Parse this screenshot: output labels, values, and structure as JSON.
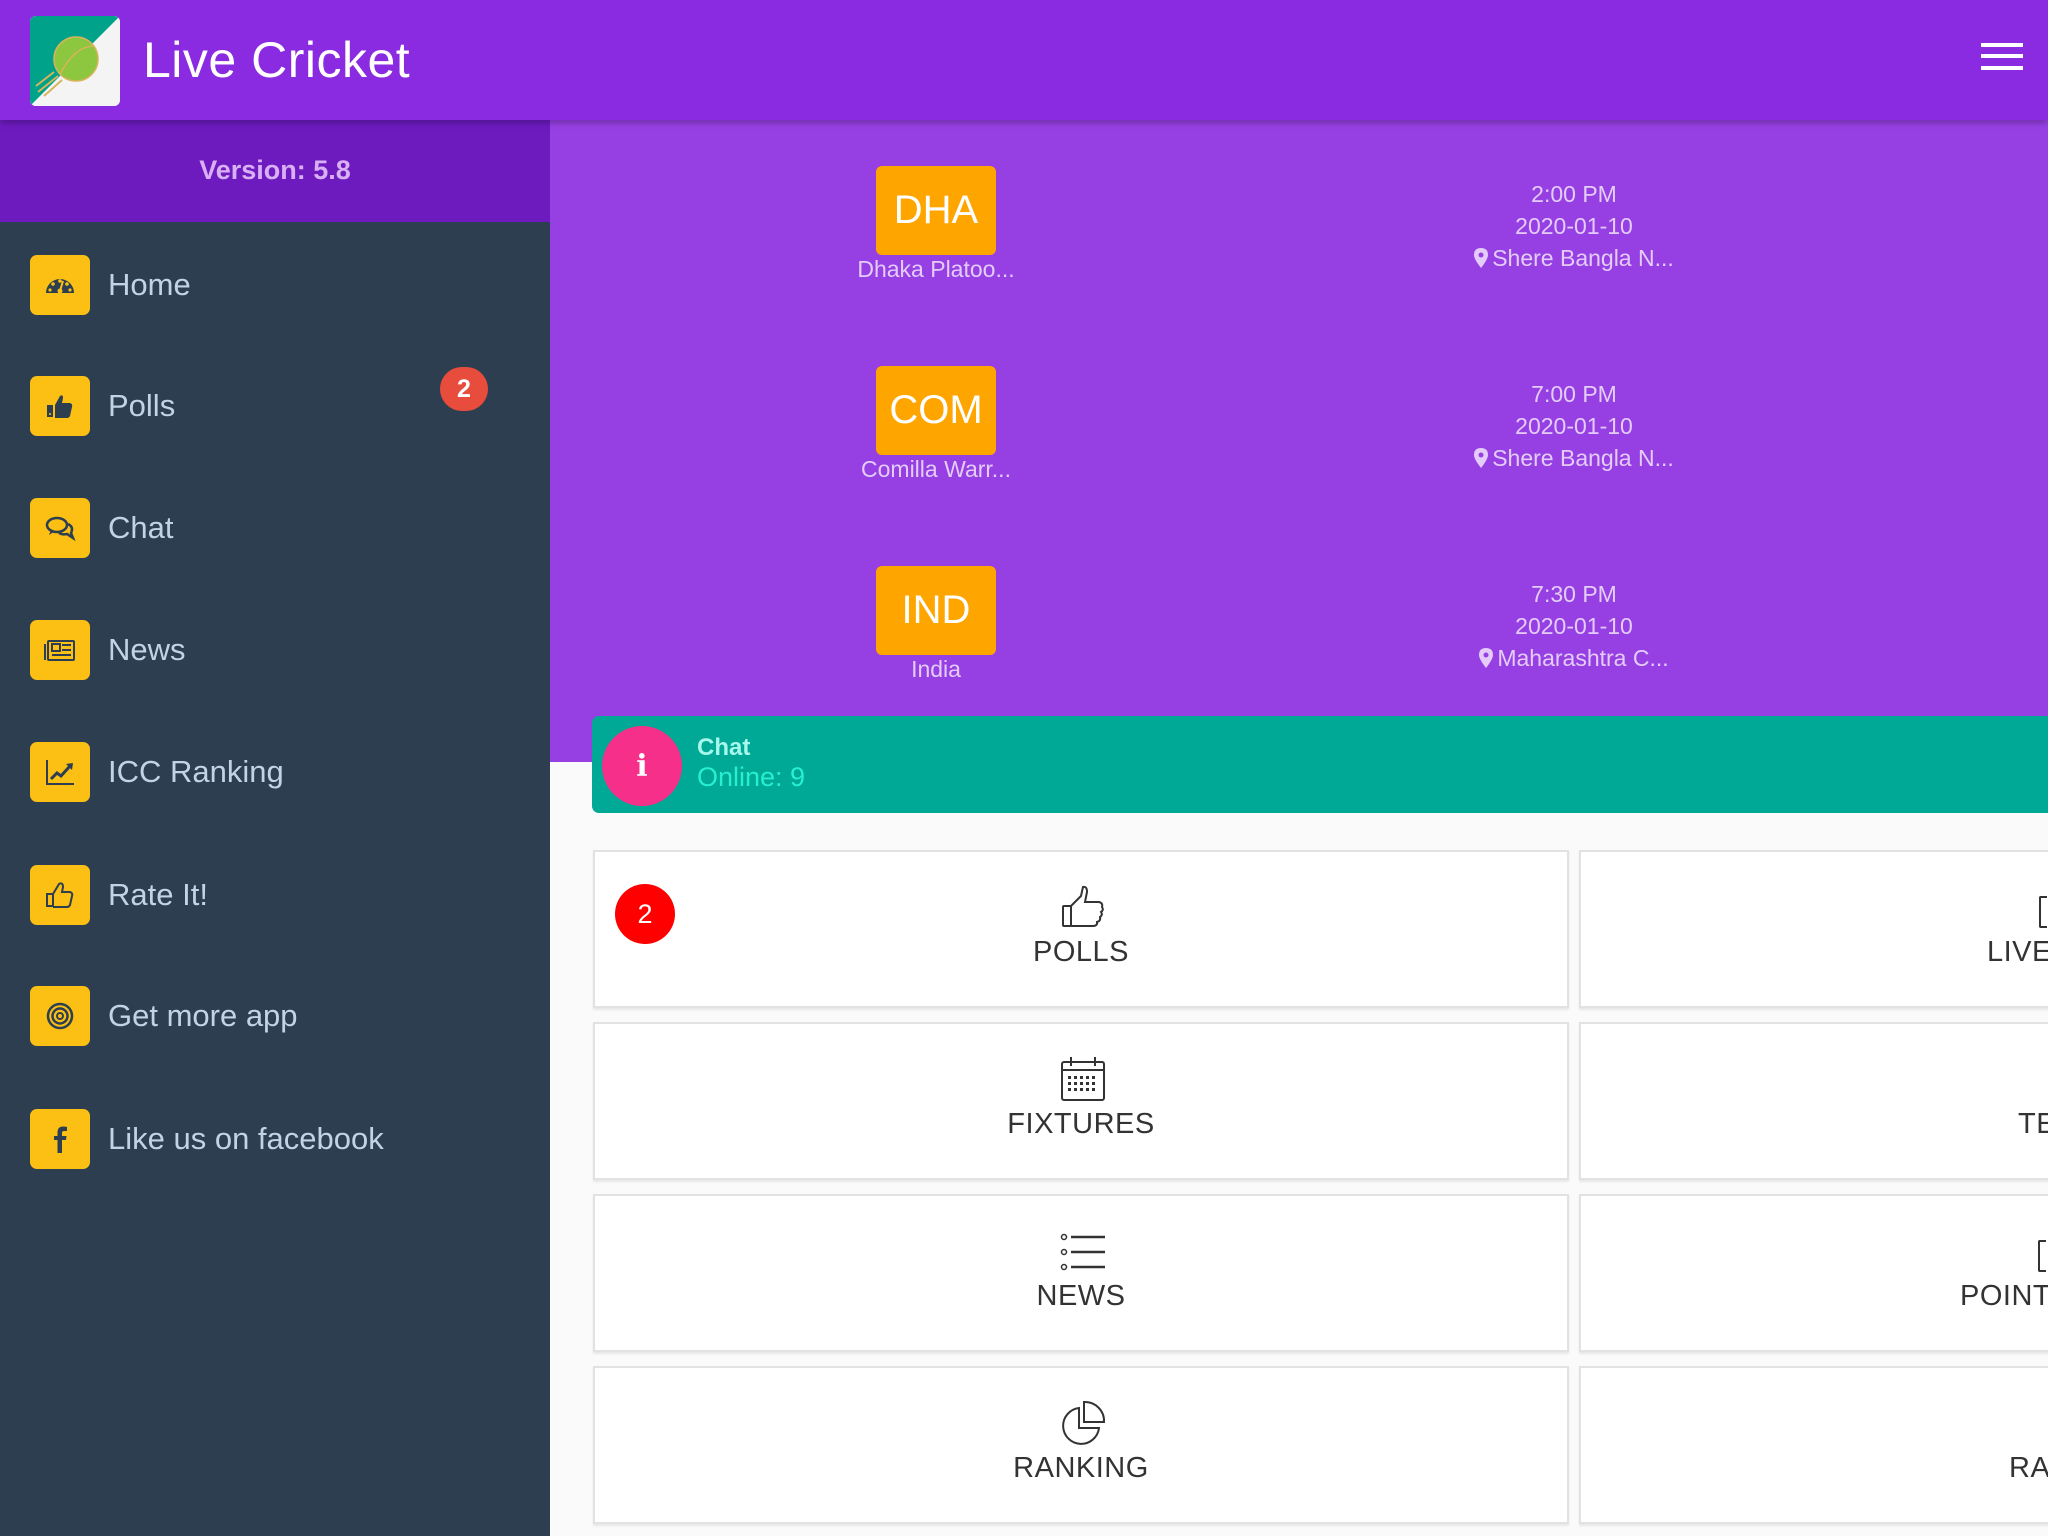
{
  "header": {
    "title": "Live Cricket",
    "logo_icon": "cricket-ball-logo",
    "menu_icon": "hamburger-menu-icon"
  },
  "sidebar": {
    "version": "Version: 5.8",
    "items": [
      {
        "label": "Home",
        "icon": "dashboard-icon"
      },
      {
        "label": "Polls",
        "icon": "thumbs-up-icon",
        "badge": "2"
      },
      {
        "label": "Chat",
        "icon": "chat-bubbles-icon"
      },
      {
        "label": "News",
        "icon": "newspaper-icon"
      },
      {
        "label": "ICC Ranking",
        "icon": "line-chart-icon"
      },
      {
        "label": "Rate It!",
        "icon": "thumbs-up-outline-icon"
      },
      {
        "label": "Get more app",
        "icon": "target-icon"
      },
      {
        "label": "Like us on facebook",
        "icon": "facebook-icon"
      }
    ],
    "icon_bg_color": "#fcc014",
    "bg_color": "#2c3e50",
    "badge_color": "#e74c3c"
  },
  "fixtures": [
    {
      "team_code": "DHA",
      "team_name": "Dhaka Platoo...",
      "time": "2:00 PM",
      "date": "2020-01-10",
      "venue": "Shere Bangla N..."
    },
    {
      "team_code": "COM",
      "team_name": "Comilla Warr...",
      "time": "7:00 PM",
      "date": "2020-01-10",
      "venue": "Shere Bangla N..."
    },
    {
      "team_code": "IND",
      "team_name": "India",
      "time": "7:30 PM",
      "date": "2020-01-10",
      "venue": "Maharashtra C..."
    }
  ],
  "chat": {
    "title": "Chat",
    "online": "Online: 9",
    "icon": "info-icon"
  },
  "cards": {
    "left": [
      {
        "label": "POLLS",
        "icon": "thumbs-up-outline-icon",
        "badge": "2"
      },
      {
        "label": "FIXTURES",
        "icon": "calendar-icon"
      },
      {
        "label": "NEWS",
        "icon": "list-icon"
      },
      {
        "label": "RANKING",
        "icon": "pie-chart-icon"
      }
    ],
    "right_visible": [
      {
        "label": "LIVE"
      },
      {
        "label": "TE"
      },
      {
        "label": "POINT"
      },
      {
        "label": "RA"
      }
    ]
  },
  "colors": {
    "header": "#8a2be2",
    "version_bar": "#6d1bbf",
    "fixtures_bg": "#9640e3",
    "team_box": "#ffa500",
    "chat_bar": "#00a896",
    "chat_avatar": "#f52f8a",
    "card_badge": "#ff0000"
  }
}
